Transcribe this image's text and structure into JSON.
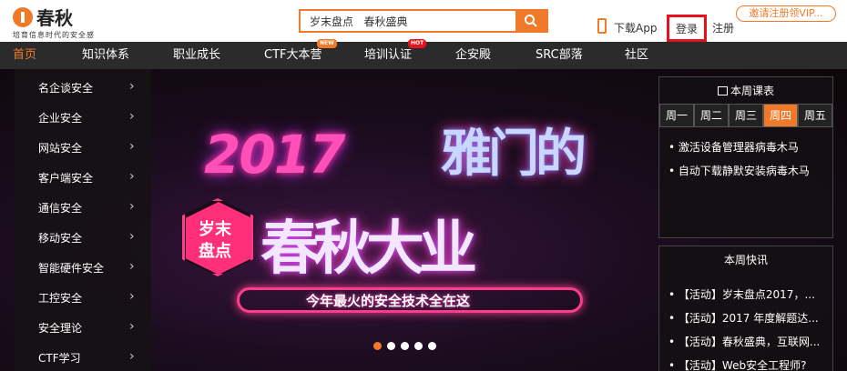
{
  "brand": {
    "name": "春秋",
    "slogan": "培育信息时代的安全感"
  },
  "search": {
    "value": "岁末盘点   春秋盛典"
  },
  "header": {
    "download": "下载App",
    "login": "登录",
    "register": "注册",
    "invite": "邀请注册领VIP..."
  },
  "nav": {
    "items": [
      {
        "label": "首页",
        "active": true
      },
      {
        "label": "知识体系"
      },
      {
        "label": "职业成长"
      },
      {
        "label": "CTF大本营",
        "badge": "NEW"
      },
      {
        "label": "培训认证",
        "badge": "HOT"
      },
      {
        "label": "企安殿"
      },
      {
        "label": "SRC部落"
      },
      {
        "label": "社区"
      }
    ]
  },
  "categories": [
    "名企谈安全",
    "企业安全",
    "网站安全",
    "客户端安全",
    "通信安全",
    "移动安全",
    "智能硬件安全",
    "工控安全",
    "安全理论",
    "CTF学习"
  ],
  "banner": {
    "year": "2017",
    "headline": "雅门的",
    "de": "的",
    "badge_line1": "岁末",
    "badge_line2": "盘点",
    "title": "春秋大业",
    "slogan": "今年最火的安全技术全在这",
    "slide_count": 5,
    "active_slide": 0
  },
  "schedule": {
    "title": "本周课表",
    "days": [
      "周一",
      "周二",
      "周三",
      "周四",
      "周五"
    ],
    "active_day": 3,
    "items": [
      "激活设备管理器病毒木马",
      "自动下载静默安装病毒木马"
    ]
  },
  "news": {
    "title": "本周快讯",
    "items": [
      "【活动】岁末盘点2017，...",
      "【活动】2017 年度解题达...",
      "【活动】春秋盛典，互联网...",
      "【活动】Web安全工程师?"
    ]
  },
  "colors": {
    "accent": "#f07a2a",
    "nav_bg": "#2b2b2b",
    "login_border": "#e8101a"
  }
}
